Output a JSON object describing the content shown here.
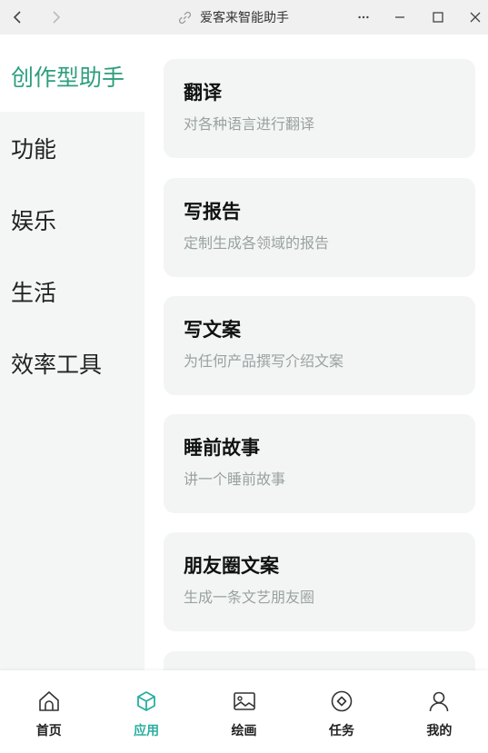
{
  "window": {
    "title": "爱客来智能助手",
    "icons": [
      "back-arrow-icon",
      "forward-arrow-icon",
      "link-icon",
      "more-icon",
      "minimize-icon",
      "maximize-icon",
      "close-icon"
    ]
  },
  "sidebar": {
    "items": [
      {
        "label": "创作型助手",
        "active": true
      },
      {
        "label": "功能",
        "active": false
      },
      {
        "label": "娱乐",
        "active": false
      },
      {
        "label": "生活",
        "active": false
      },
      {
        "label": "效率工具",
        "active": false
      }
    ]
  },
  "cards": [
    {
      "title": "翻译",
      "desc": "对各种语言进行翻译"
    },
    {
      "title": "写报告",
      "desc": "定制生成各领域的报告"
    },
    {
      "title": "写文案",
      "desc": "为任何产品撰写介绍文案"
    },
    {
      "title": "睡前故事",
      "desc": "讲一个睡前故事"
    },
    {
      "title": "朋友圈文案",
      "desc": "生成一条文艺朋友圈"
    }
  ],
  "bottom_nav": {
    "items": [
      {
        "label": "首页",
        "icon": "home-icon"
      },
      {
        "label": "应用",
        "icon": "cube-icon",
        "active": true
      },
      {
        "label": "绘画",
        "icon": "image-icon"
      },
      {
        "label": "任务",
        "icon": "task-circle-icon"
      },
      {
        "label": "我的",
        "icon": "user-icon"
      }
    ]
  },
  "colors": {
    "accent": "#2e9e7f",
    "nav_active": "#2aaea0",
    "sidebar_bg": "#f4f5f5",
    "card_bg": "#f3f5f5"
  }
}
